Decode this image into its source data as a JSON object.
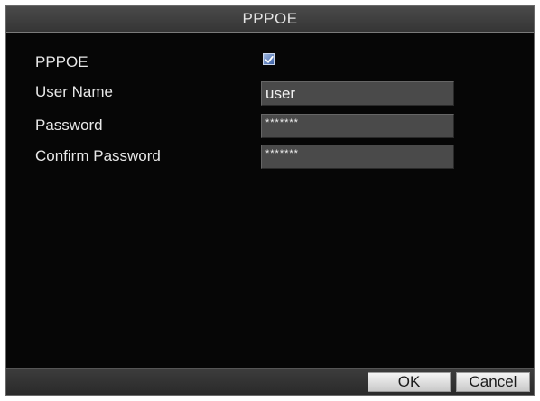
{
  "dialog": {
    "title": "PPPOE"
  },
  "form": {
    "pppoe": {
      "label": "PPPOE",
      "checked": true
    },
    "user_name": {
      "label": "User Name",
      "value": "user"
    },
    "password": {
      "label": "Password",
      "value": "*******"
    },
    "confirm_password": {
      "label": "Confirm Password",
      "value": "*******"
    }
  },
  "buttons": {
    "ok_label": "OK",
    "cancel_label": "Cancel"
  },
  "colors": {
    "background": "#060606",
    "title_bar": "#404040",
    "input_bg": "#4a4a4a",
    "checkbox_fill": "#5577bb",
    "text": "#e8e8e8"
  },
  "icons": {
    "checkbox": "checkmark-icon"
  }
}
